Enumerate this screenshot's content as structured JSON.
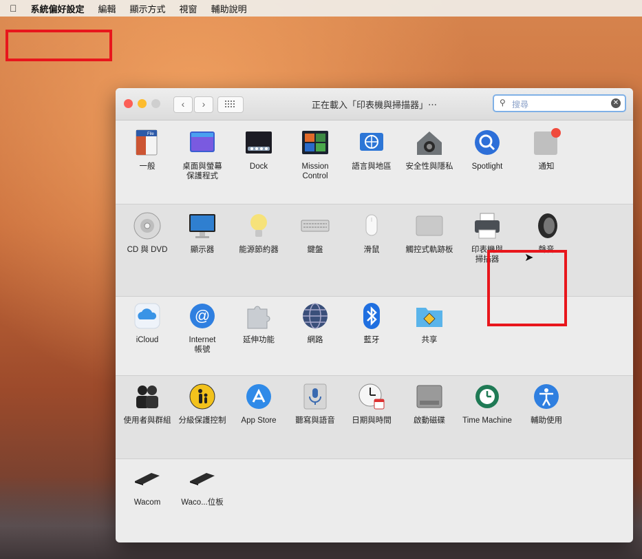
{
  "menubar": {
    "apple_icon": "apple-icon",
    "items": [
      "系統偏好設定",
      "編輯",
      "顯示方式",
      "視窗",
      "輔助說明"
    ]
  },
  "window": {
    "title": "正在載入「印表機與掃描器」⋯",
    "search": {
      "placeholder": "搜尋",
      "clear_icon": "x-circle-icon"
    },
    "nav": {
      "back": "‹",
      "forward": "›",
      "grid_icon": "grid-icon"
    }
  },
  "rows": [
    [
      {
        "id": "general",
        "label": "一般",
        "icon": "file-icon"
      },
      {
        "id": "desktop-screensaver",
        "label": "桌面與螢幕\n保護程式",
        "icon": "desktop-icon"
      },
      {
        "id": "dock",
        "label": "Dock",
        "icon": "dock-icon"
      },
      {
        "id": "mission-control",
        "label": "Mission\nControl",
        "icon": "mission-control-icon"
      },
      {
        "id": "language-region",
        "label": "語言與地區",
        "icon": "flag-icon"
      },
      {
        "id": "security-privacy",
        "label": "安全性與隱私",
        "icon": "house-lock-icon"
      },
      {
        "id": "spotlight",
        "label": "Spotlight",
        "icon": "magnifier-icon"
      },
      {
        "id": "notifications",
        "label": "通知",
        "icon": "notification-icon"
      }
    ],
    [
      {
        "id": "cd-dvd",
        "label": "CD 與 DVD",
        "icon": "disc-icon"
      },
      {
        "id": "displays",
        "label": "顯示器",
        "icon": "monitor-icon"
      },
      {
        "id": "energy-saver",
        "label": "能源節約器",
        "icon": "bulb-icon"
      },
      {
        "id": "keyboard",
        "label": "鍵盤",
        "icon": "keyboard-icon"
      },
      {
        "id": "mouse",
        "label": "滑鼠",
        "icon": "mouse-icon"
      },
      {
        "id": "trackpad",
        "label": "觸控式軌跡板",
        "icon": "trackpad-icon"
      },
      {
        "id": "printers-scanners",
        "label": "印表機與\n掃描器",
        "icon": "printer-icon"
      },
      {
        "id": "sound",
        "label": "聲音",
        "icon": "speaker-icon"
      }
    ],
    [
      {
        "id": "icloud",
        "label": "iCloud",
        "icon": "cloud-icon"
      },
      {
        "id": "internet-accounts",
        "label": "Internet\n帳號",
        "icon": "at-icon"
      },
      {
        "id": "extensions",
        "label": "延伸功能",
        "icon": "puzzle-icon"
      },
      {
        "id": "network",
        "label": "網路",
        "icon": "globe-icon"
      },
      {
        "id": "bluetooth",
        "label": "藍牙",
        "icon": "bluetooth-icon"
      },
      {
        "id": "sharing",
        "label": "共享",
        "icon": "folder-share-icon"
      }
    ],
    [
      {
        "id": "users-groups",
        "label": "使用者與群組",
        "icon": "users-icon"
      },
      {
        "id": "parental-controls",
        "label": "分級保護控制",
        "icon": "parental-icon"
      },
      {
        "id": "app-store",
        "label": "App Store",
        "icon": "appstore-icon"
      },
      {
        "id": "dictation-speech",
        "label": "聽寫與語音",
        "icon": "microphone-icon"
      },
      {
        "id": "date-time",
        "label": "日期與時間",
        "icon": "clock-calendar-icon"
      },
      {
        "id": "startup-disk",
        "label": "啟動磁碟",
        "icon": "harddisk-icon"
      },
      {
        "id": "time-machine",
        "label": "Time Machine",
        "icon": "time-machine-icon"
      },
      {
        "id": "accessibility",
        "label": "輔助使用",
        "icon": "accessibility-icon"
      }
    ],
    [
      {
        "id": "wacom",
        "label": "Wacom",
        "icon": "tablet-icon"
      },
      {
        "id": "wacom-tablet",
        "label": "Waco...位板",
        "icon": "tablet-icon"
      }
    ]
  ]
}
